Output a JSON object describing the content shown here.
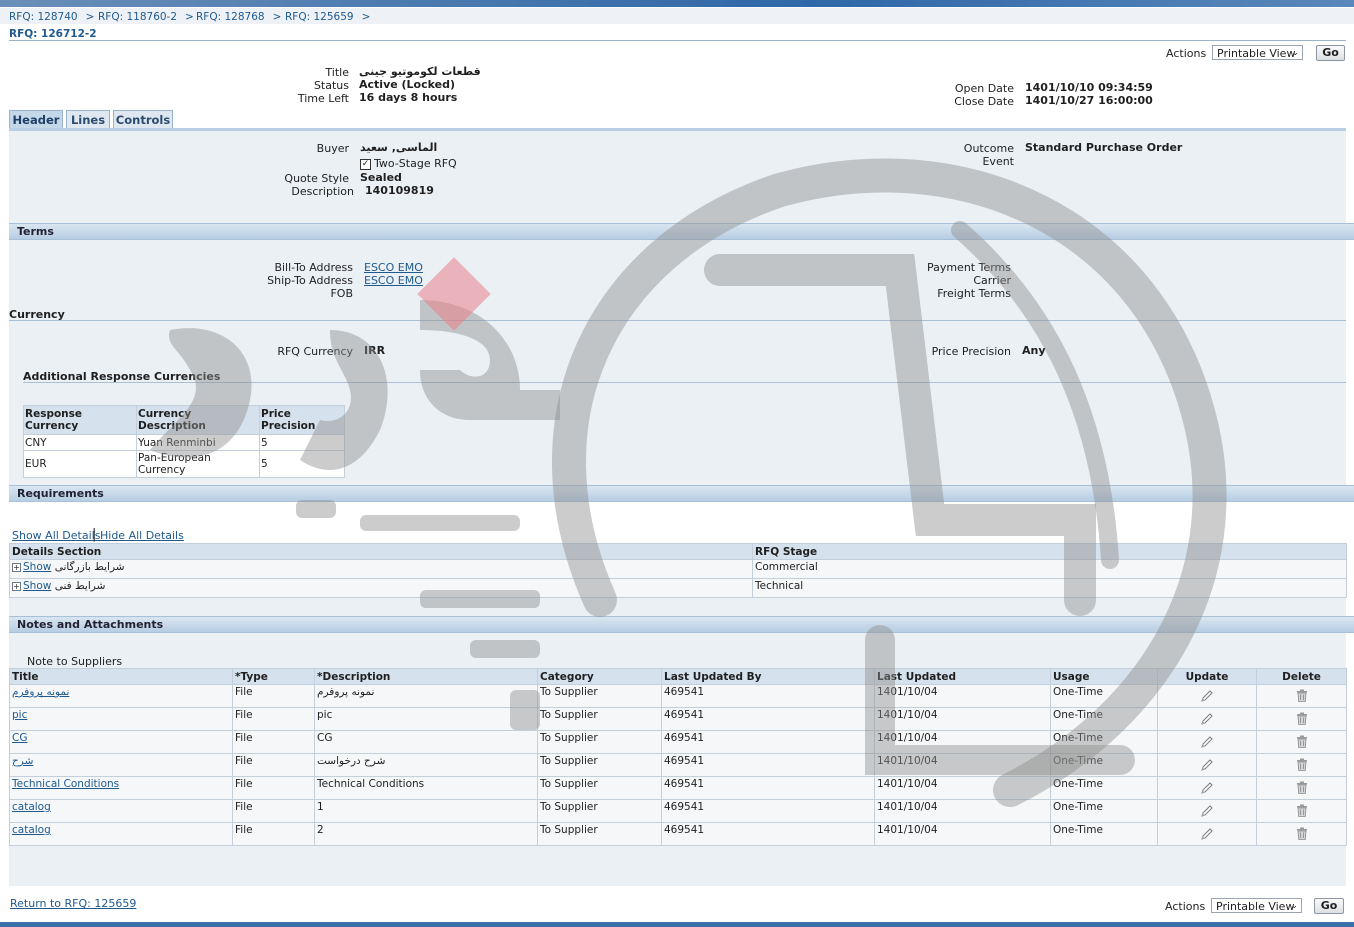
{
  "breadcrumbs": [
    "RFQ: 128740",
    "RFQ: 118760-2",
    "RFQ: 128768",
    "RFQ: 125659"
  ],
  "page_title": "RFQ: 126712-2",
  "actions": {
    "label": "Actions",
    "selected": "Printable View",
    "go": "Go"
  },
  "summary": {
    "title_label": "Title",
    "title_value": "قطعات لکوموتیو جینی",
    "status_label": "Status",
    "status_value": "Active (Locked)",
    "timeleft_label": "Time Left",
    "timeleft_value": "16 days 8 hours",
    "open_label": "Open Date",
    "open_value": "1401/10/10 09:34:59",
    "close_label": "Close Date",
    "close_value": "1401/10/27 16:00:00"
  },
  "tabs": [
    "Header",
    "Lines",
    "Controls"
  ],
  "header": {
    "buyer_label": "Buyer",
    "buyer_value": "الماسی, سعید",
    "two_stage": "Two-Stage RFQ",
    "quote_style_label": "Quote Style",
    "quote_style_value": "Sealed",
    "description_label": "Description",
    "description_value": "140109819",
    "outcome_label": "Outcome",
    "outcome_value": "Standard Purchase Order",
    "event_label": "Event"
  },
  "terms": {
    "title": "Terms",
    "bill_to_label": "Bill-To Address",
    "bill_to_value": "ESCO EMO",
    "ship_to_label": "Ship-To Address",
    "ship_to_value": "ESCO EMO",
    "fob_label": "FOB",
    "payment_terms_label": "Payment Terms",
    "carrier_label": "Carrier",
    "freight_terms_label": "Freight Terms"
  },
  "currency": {
    "title": "Currency",
    "rfq_currency_label": "RFQ Currency",
    "rfq_currency_value": "IRR",
    "price_precision_label": "Price Precision",
    "price_precision_value": "Any",
    "additional_title": "Additional Response Currencies",
    "columns": [
      "Response Currency",
      "Currency Description",
      "Price Precision"
    ],
    "rows": [
      [
        "CNY",
        "Yuan Renminbi",
        "5"
      ],
      [
        "EUR",
        "Pan-European Currency",
        "5"
      ]
    ]
  },
  "requirements": {
    "title": "Requirements",
    "show_all": "Show All Details",
    "hide_all": "Hide All Details",
    "columns": [
      "Details Section",
      "RFQ Stage"
    ],
    "show_label": "Show",
    "rows": [
      {
        "section": "شرایط بازرگانی",
        "stage": "Commercial"
      },
      {
        "section": "شرایط فنی",
        "stage": "Technical"
      }
    ]
  },
  "notes": {
    "title": "Notes and Attachments",
    "subtitle": "Note to Suppliers",
    "columns": [
      "Title",
      "*Type",
      "*Description",
      "Category",
      "Last Updated By",
      "Last Updated",
      "Usage",
      "Update",
      "Delete"
    ],
    "rows": [
      {
        "title": "نمونه پروفرم",
        "type": "File",
        "description": "نمونه پروفرم",
        "category": "To Supplier",
        "by": "469541",
        "updated": "1401/10/04",
        "usage": "One-Time"
      },
      {
        "title": "pic",
        "type": "File",
        "description": "pic",
        "category": "To Supplier",
        "by": "469541",
        "updated": "1401/10/04",
        "usage": "One-Time"
      },
      {
        "title": "CG",
        "type": "File",
        "description": "CG",
        "category": "To Supplier",
        "by": "469541",
        "updated": "1401/10/04",
        "usage": "One-Time"
      },
      {
        "title": "شرح",
        "type": "File",
        "description": "شرح درخواست",
        "category": "To Supplier",
        "by": "469541",
        "updated": "1401/10/04",
        "usage": "One-Time"
      },
      {
        "title": "Technical Conditions",
        "type": "File",
        "description": "Technical Conditions",
        "category": "To Supplier",
        "by": "469541",
        "updated": "1401/10/04",
        "usage": "One-Time"
      },
      {
        "title": "catalog",
        "type": "File",
        "description": "1",
        "category": "To Supplier",
        "by": "469541",
        "updated": "1401/10/04",
        "usage": "One-Time"
      },
      {
        "title": "catalog",
        "type": "File",
        "description": "2",
        "category": "To Supplier",
        "by": "469541",
        "updated": "1401/10/04",
        "usage": "One-Time"
      }
    ]
  },
  "footer": {
    "return_link": "Return to RFQ: 125659"
  },
  "watermark": {
    "text_main": "هزاره",
    "text_sub": "ارتباط گستران"
  },
  "colors": {
    "accent": "#1f5a8f",
    "section_header": "#c7d8ea",
    "panel": "#ebf0f5"
  }
}
